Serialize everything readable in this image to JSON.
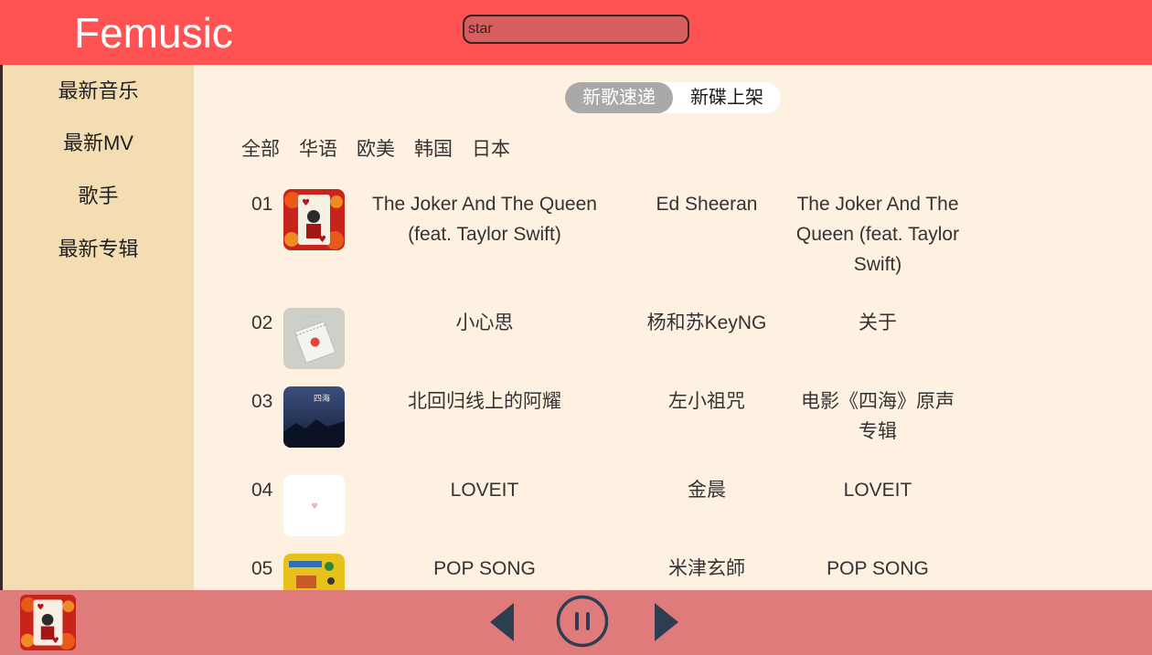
{
  "app": {
    "title": "Femusic"
  },
  "search": {
    "value": "star"
  },
  "sidebar": {
    "items": [
      {
        "label": "最新音乐"
      },
      {
        "label": "最新MV"
      },
      {
        "label": "歌手"
      },
      {
        "label": "最新专辑"
      }
    ]
  },
  "tabs": {
    "active": "新歌速递",
    "inactive": "新碟上架"
  },
  "filters": [
    "全部",
    "华语",
    "欧美",
    "韩国",
    "日本"
  ],
  "songs": [
    {
      "num": "01",
      "title_lines": [
        "The Joker And The Queen",
        "(feat. Taylor Swift)"
      ],
      "artist": "Ed Sheeran",
      "album_lines": [
        "The Joker And The",
        "Queen (feat. Taylor",
        "Swift)"
      ]
    },
    {
      "num": "02",
      "title_lines": [
        "小心思"
      ],
      "artist": "杨和苏KeyNG",
      "album_lines": [
        "关于"
      ]
    },
    {
      "num": "03",
      "title_lines": [
        "北回归线上的阿耀"
      ],
      "artist": "左小祖咒",
      "album_lines": [
        "电影《四海》原声",
        "专辑"
      ]
    },
    {
      "num": "04",
      "title_lines": [
        "LOVEIT"
      ],
      "artist": "金晨",
      "album_lines": [
        "LOVEIT"
      ]
    },
    {
      "num": "05",
      "title_lines": [
        "POP SONG"
      ],
      "artist": "米津玄師",
      "album_lines": [
        "POP SONG"
      ]
    }
  ],
  "colors": {
    "header": "#ff5252",
    "sidebar": "#f4ddb3",
    "content": "#fff1e2",
    "player": "#e07b7b",
    "control_icons": "#2c3e50"
  },
  "icons": {
    "prev": "play-previous-icon",
    "pause": "pause-circle-icon",
    "next": "play-next-icon"
  }
}
